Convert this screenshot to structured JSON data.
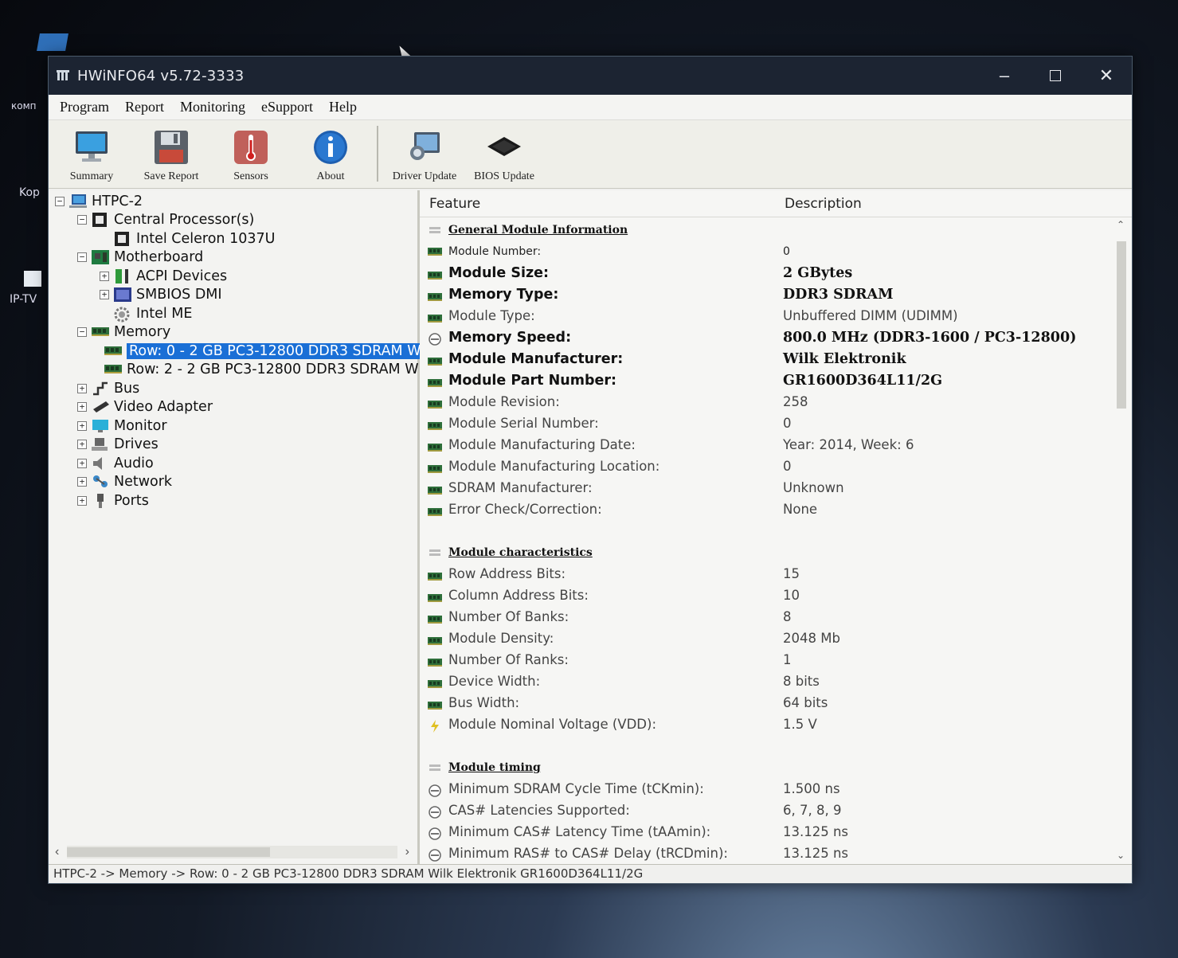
{
  "window": {
    "title": "HWiNFO64 v5.72-3333"
  },
  "menu": [
    "Program",
    "Report",
    "Monitoring",
    "eSupport",
    "Help"
  ],
  "toolbar": [
    {
      "label": "Summary",
      "icon": "monitor-icon"
    },
    {
      "label": "Save Report",
      "icon": "floppy-icon"
    },
    {
      "label": "Sensors",
      "icon": "thermometer-icon"
    },
    {
      "label": "About",
      "icon": "info-icon"
    },
    {
      "label": "Driver Update",
      "icon": "driver-update-icon"
    },
    {
      "label": "BIOS Update",
      "icon": "bios-chip-icon"
    }
  ],
  "tree": [
    {
      "label": "HTPC-2",
      "level": 0,
      "expander": "-",
      "icon": "computer-icon"
    },
    {
      "label": "Central Processor(s)",
      "level": 1,
      "expander": "-",
      "icon": "cpu-icon"
    },
    {
      "label": "Intel Celeron 1037U",
      "level": 2,
      "expander": "",
      "icon": "cpu-icon"
    },
    {
      "label": "Motherboard",
      "level": 1,
      "expander": "-",
      "icon": "motherboard-icon"
    },
    {
      "label": "ACPI Devices",
      "level": 2,
      "expander": "+",
      "icon": "acpi-icon"
    },
    {
      "label": "SMBIOS DMI",
      "level": 2,
      "expander": "+",
      "icon": "smbios-icon"
    },
    {
      "label": "Intel ME",
      "level": 2,
      "expander": "",
      "icon": "gear-icon"
    },
    {
      "label": "Memory",
      "level": 1,
      "expander": "-",
      "icon": "memory-icon"
    },
    {
      "label": "Row: 0 - 2 GB PC3-12800 DDR3 SDRAM W",
      "level": 2,
      "expander": "",
      "icon": "memory-icon",
      "selected": true
    },
    {
      "label": "Row: 2 - 2 GB PC3-12800 DDR3 SDRAM W",
      "level": 2,
      "expander": "",
      "icon": "memory-icon"
    },
    {
      "label": "Bus",
      "level": 1,
      "expander": "+",
      "icon": "bus-icon"
    },
    {
      "label": "Video Adapter",
      "level": 1,
      "expander": "+",
      "icon": "video-adapter-icon"
    },
    {
      "label": "Monitor",
      "level": 1,
      "expander": "+",
      "icon": "monitor-icon"
    },
    {
      "label": "Drives",
      "level": 1,
      "expander": "+",
      "icon": "drives-icon"
    },
    {
      "label": "Audio",
      "level": 1,
      "expander": "+",
      "icon": "audio-icon"
    },
    {
      "label": "Network",
      "level": 1,
      "expander": "+",
      "icon": "network-icon"
    },
    {
      "label": "Ports",
      "level": 1,
      "expander": "+",
      "icon": "ports-icon"
    }
  ],
  "columns": {
    "feature": "Feature",
    "description": "Description"
  },
  "details": [
    {
      "type": "section",
      "feature": "General Module Information",
      "value": ""
    },
    {
      "type": "small",
      "feature": "Module Number:",
      "value": "0",
      "icon": "memory"
    },
    {
      "type": "bold",
      "feature": "Module Size:",
      "value": "2 GBytes",
      "icon": "memory"
    },
    {
      "type": "bold",
      "feature": "Memory Type:",
      "value": "DDR3 SDRAM",
      "icon": "memory"
    },
    {
      "type": "normal",
      "feature": "Module Type:",
      "value": "Unbuffered DIMM (UDIMM)",
      "icon": "memory"
    },
    {
      "type": "bold",
      "feature": "Memory Speed:",
      "value": "800.0 MHz (DDR3-1600 / PC3-12800)",
      "icon": "clock"
    },
    {
      "type": "bold",
      "feature": "Module Manufacturer:",
      "value": "Wilk Elektronik",
      "icon": "memory"
    },
    {
      "type": "bold",
      "feature": "Module Part Number:",
      "value": "GR1600D364L11/2G",
      "icon": "memory"
    },
    {
      "type": "normal",
      "feature": "Module Revision:",
      "value": "258",
      "icon": "memory"
    },
    {
      "type": "normal",
      "feature": "Module Serial Number:",
      "value": "0",
      "icon": "memory"
    },
    {
      "type": "normal",
      "feature": "Module Manufacturing Date:",
      "value": "Year: 2014, Week: 6",
      "icon": "memory"
    },
    {
      "type": "normal",
      "feature": "Module Manufacturing Location:",
      "value": "0",
      "icon": "memory"
    },
    {
      "type": "normal",
      "feature": "SDRAM Manufacturer:",
      "value": "Unknown",
      "icon": "memory"
    },
    {
      "type": "normal",
      "feature": "Error Check/Correction:",
      "value": "None",
      "icon": "memory"
    },
    {
      "type": "spacer",
      "feature": "",
      "value": ""
    },
    {
      "type": "section",
      "feature": "Module characteristics",
      "value": ""
    },
    {
      "type": "normal",
      "feature": "Row Address Bits:",
      "value": "15",
      "icon": "memory"
    },
    {
      "type": "normal",
      "feature": "Column Address Bits:",
      "value": "10",
      "icon": "memory"
    },
    {
      "type": "normal",
      "feature": "Number Of Banks:",
      "value": "8",
      "icon": "memory"
    },
    {
      "type": "normal",
      "feature": "Module Density:",
      "value": "2048 Mb",
      "icon": "memory"
    },
    {
      "type": "normal",
      "feature": "Number Of Ranks:",
      "value": "1",
      "icon": "memory"
    },
    {
      "type": "normal",
      "feature": "Device Width:",
      "value": "8 bits",
      "icon": "memory"
    },
    {
      "type": "normal",
      "feature": "Bus Width:",
      "value": "64 bits",
      "icon": "memory"
    },
    {
      "type": "normal",
      "feature": "Module Nominal Voltage (VDD):",
      "value": "1.5 V",
      "icon": "voltage"
    },
    {
      "type": "spacer",
      "feature": "",
      "value": ""
    },
    {
      "type": "section",
      "feature": "Module timing",
      "value": ""
    },
    {
      "type": "normal",
      "feature": "Minimum SDRAM Cycle Time (tCKmin):",
      "value": "1.500 ns",
      "icon": "clock"
    },
    {
      "type": "normal",
      "feature": "CAS# Latencies Supported:",
      "value": "6, 7, 8, 9",
      "icon": "clock"
    },
    {
      "type": "normal",
      "feature": "Minimum CAS# Latency Time (tAAmin):",
      "value": "13.125 ns",
      "icon": "clock"
    },
    {
      "type": "normal",
      "feature": "Minimum RAS# to CAS# Delay (tRCDmin):",
      "value": "13.125 ns",
      "icon": "clock"
    }
  ],
  "statusbar": "HTPC-2 -> Memory -> Row: 0 - 2 GB PC3-12800 DDR3 SDRAM Wilk Elektronik GR1600D364L11/2G",
  "desktop": {
    "icon1_label": "IP-TV",
    "icon2_label": "Kop",
    "icon3_label": "комп"
  },
  "colors": {
    "selection": "#1a6fd6",
    "titlebar": "#1c2432",
    "memory_icon": "#2e6e3a"
  }
}
